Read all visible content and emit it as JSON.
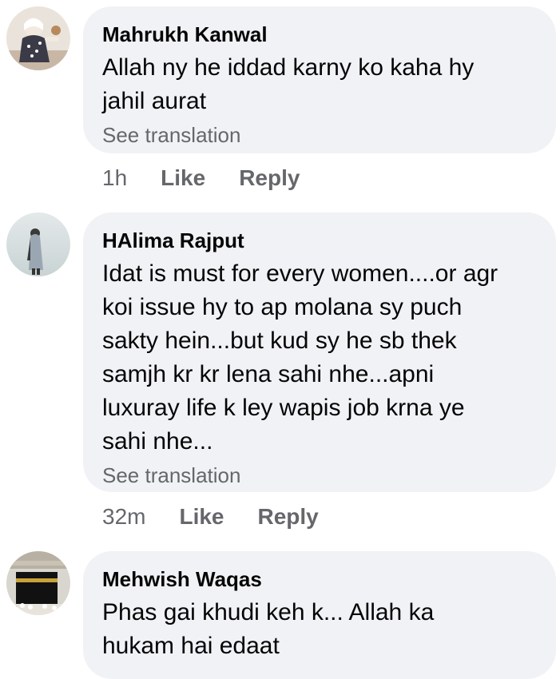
{
  "comments": [
    {
      "author": "Mahrukh Kanwal",
      "text": "Allah ny he iddad karny ko kaha hy\njahil aurat",
      "see_translation": "See translation",
      "time": "1h",
      "like": "Like",
      "reply": "Reply",
      "avatar_icon": "avatar-child-photo"
    },
    {
      "author": "HAlima Rajput",
      "text": "Idat is must for every women....or agr\nkoi issue hy to ap molana sy puch\nsakty hein...but kud sy he sb thek\nsamjh kr kr lena sahi nhe...apni\nluxuray life k ley wapis job krna ye\nsahi nhe...",
      "see_translation": "See translation",
      "time": "32m",
      "like": "Like",
      "reply": "Reply",
      "avatar_icon": "avatar-woman-photo"
    },
    {
      "author": "Mehwish Waqas",
      "text": "Phas gai khudi keh k... Allah ka\nhukam hai edaat",
      "avatar_icon": "avatar-kaaba-photo"
    }
  ],
  "colors": {
    "bubble": "#f0f2f5",
    "secondary_text": "#65676b",
    "primary_text": "#050505"
  }
}
